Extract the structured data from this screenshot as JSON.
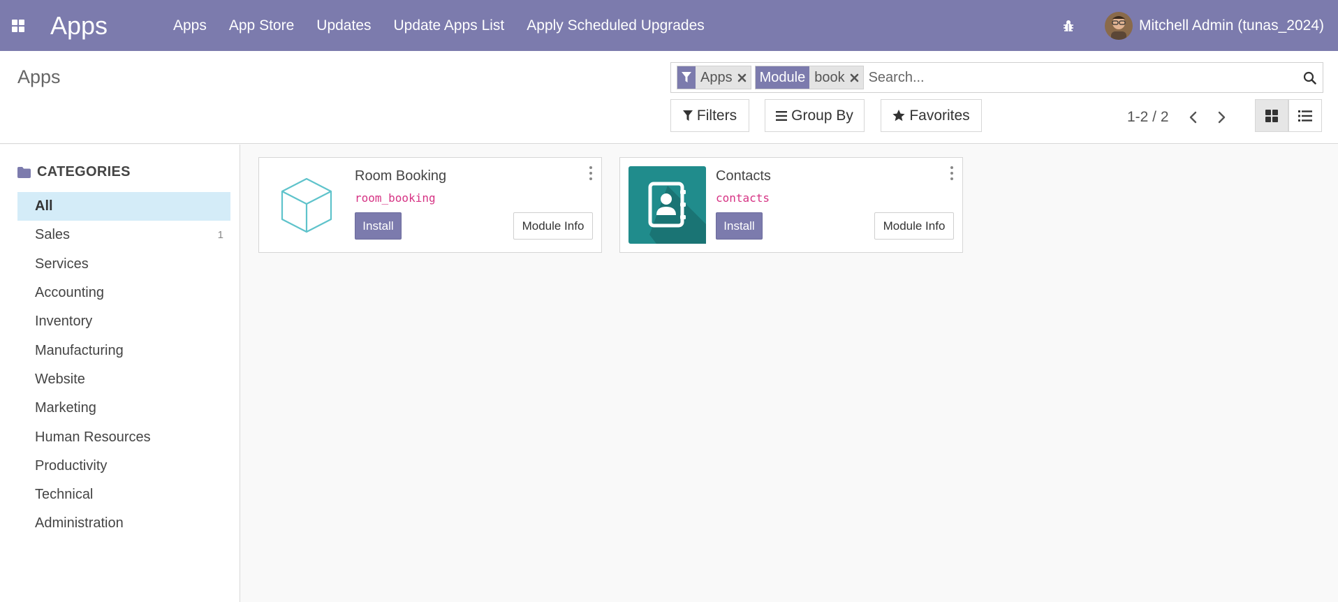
{
  "navbar": {
    "brand": "Apps",
    "menu": [
      "Apps",
      "App Store",
      "Updates",
      "Update Apps List",
      "Apply Scheduled Upgrades"
    ],
    "user": "Mitchell Admin (tunas_2024)",
    "bar_color": "#7c7bad"
  },
  "control_panel": {
    "title": "Apps",
    "facets": [
      {
        "icon": "filter-icon",
        "value": "Apps"
      },
      {
        "label": "Module",
        "value": "book"
      }
    ],
    "search_placeholder": "Search...",
    "buttons": {
      "filters": "Filters",
      "group_by": "Group By",
      "favorites": "Favorites"
    },
    "pager": "1-2 / 2"
  },
  "sidebar": {
    "header": "CATEGORIES",
    "items": [
      {
        "label": "All",
        "count": "",
        "active": true
      },
      {
        "label": "Sales",
        "count": "1"
      },
      {
        "label": "Services",
        "count": ""
      },
      {
        "label": "Accounting",
        "count": ""
      },
      {
        "label": "Inventory",
        "count": ""
      },
      {
        "label": "Manufacturing",
        "count": ""
      },
      {
        "label": "Website",
        "count": ""
      },
      {
        "label": "Marketing",
        "count": ""
      },
      {
        "label": "Human Resources",
        "count": ""
      },
      {
        "label": "Productivity",
        "count": ""
      },
      {
        "label": "Technical",
        "count": ""
      },
      {
        "label": "Administration",
        "count": ""
      }
    ]
  },
  "cards": [
    {
      "name": "Room Booking",
      "technical": "room_booking",
      "install": "Install",
      "info": "Module Info",
      "icon": "cube-icon"
    },
    {
      "name": "Contacts",
      "technical": "contacts",
      "install": "Install",
      "info": "Module Info",
      "icon": "address-book-icon"
    }
  ]
}
